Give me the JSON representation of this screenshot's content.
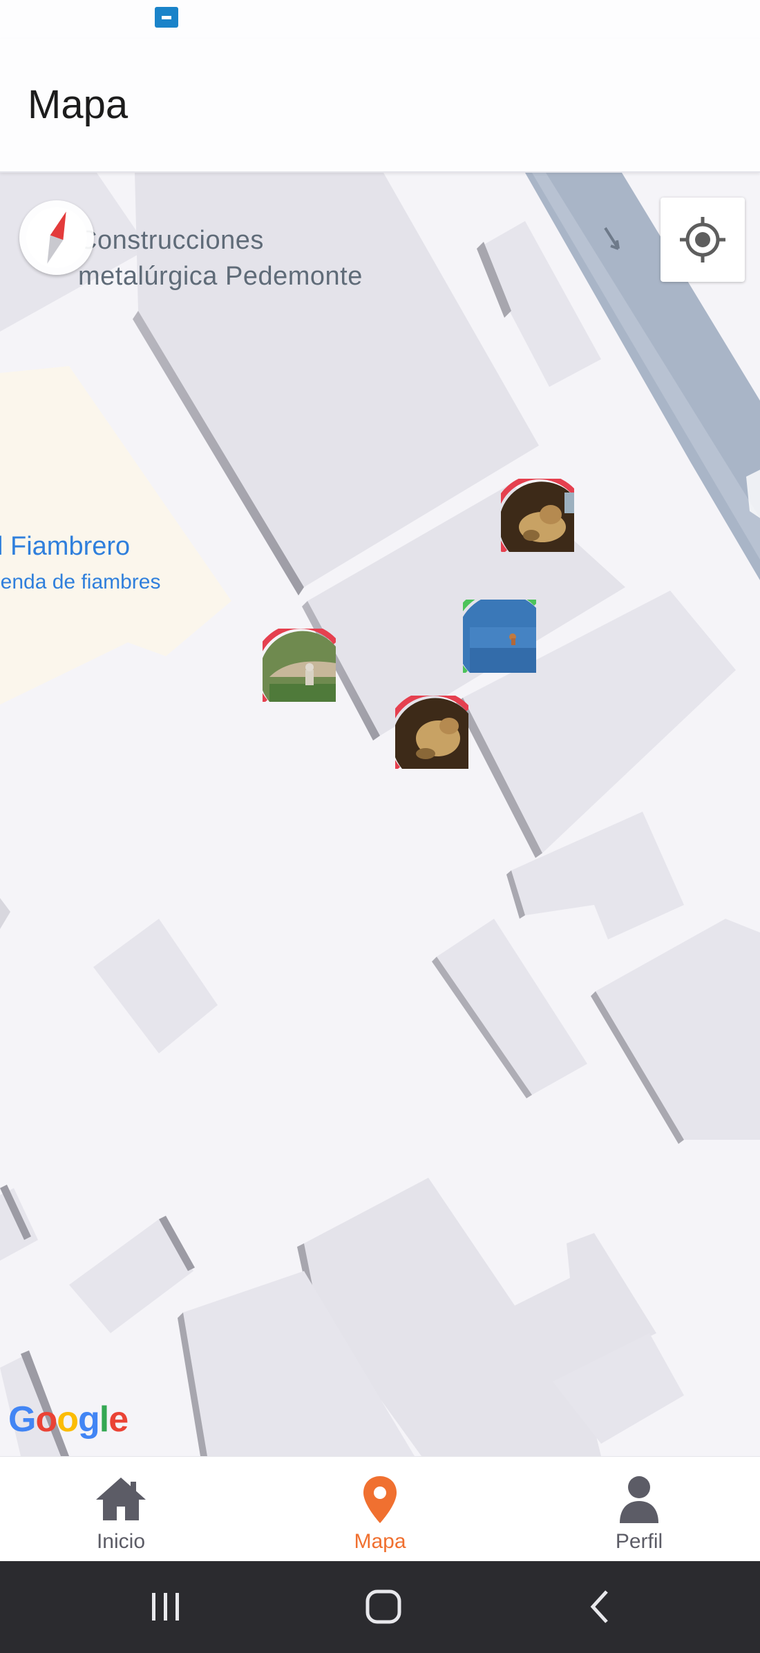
{
  "app": {
    "title": "Mapa"
  },
  "map": {
    "labels": {
      "construcciones_line1": "Construcciones",
      "construcciones_line2": "metalúrgica Pedemonte",
      "fiambrero_name": "l Fiambrero",
      "fiambrero_category": "ienda de fiambres"
    },
    "provider_logo": [
      "G",
      "o",
      "o",
      "g",
      "l",
      "e"
    ],
    "markers": [
      {
        "name": "pet-marker-1",
        "ring_color": "#e5404f",
        "thumbnail": "dog-photo"
      },
      {
        "name": "pet-marker-2",
        "ring_color": "#4cc35a",
        "thumbnail": "water-photo"
      },
      {
        "name": "pet-marker-3",
        "ring_color": "#e5404f",
        "thumbnail": "field-photo"
      },
      {
        "name": "pet-marker-4",
        "ring_color": "#e5404f",
        "thumbnail": "dog-photo"
      }
    ]
  },
  "bottom_nav": {
    "items": [
      {
        "label": "Inicio",
        "icon": "home-icon",
        "active": false
      },
      {
        "label": "Mapa",
        "icon": "location-pin-icon",
        "active": true
      },
      {
        "label": "Perfil",
        "icon": "person-icon",
        "active": false
      }
    ],
    "active_color": "#f07030",
    "inactive_color": "#5c5c66"
  },
  "colors": {
    "map_background": "#f5f4f8",
    "building": "#e6e5ec",
    "road": "#a9b5c7",
    "poi_area": "#fbf6ec",
    "status_icon": "#1a83c9"
  }
}
